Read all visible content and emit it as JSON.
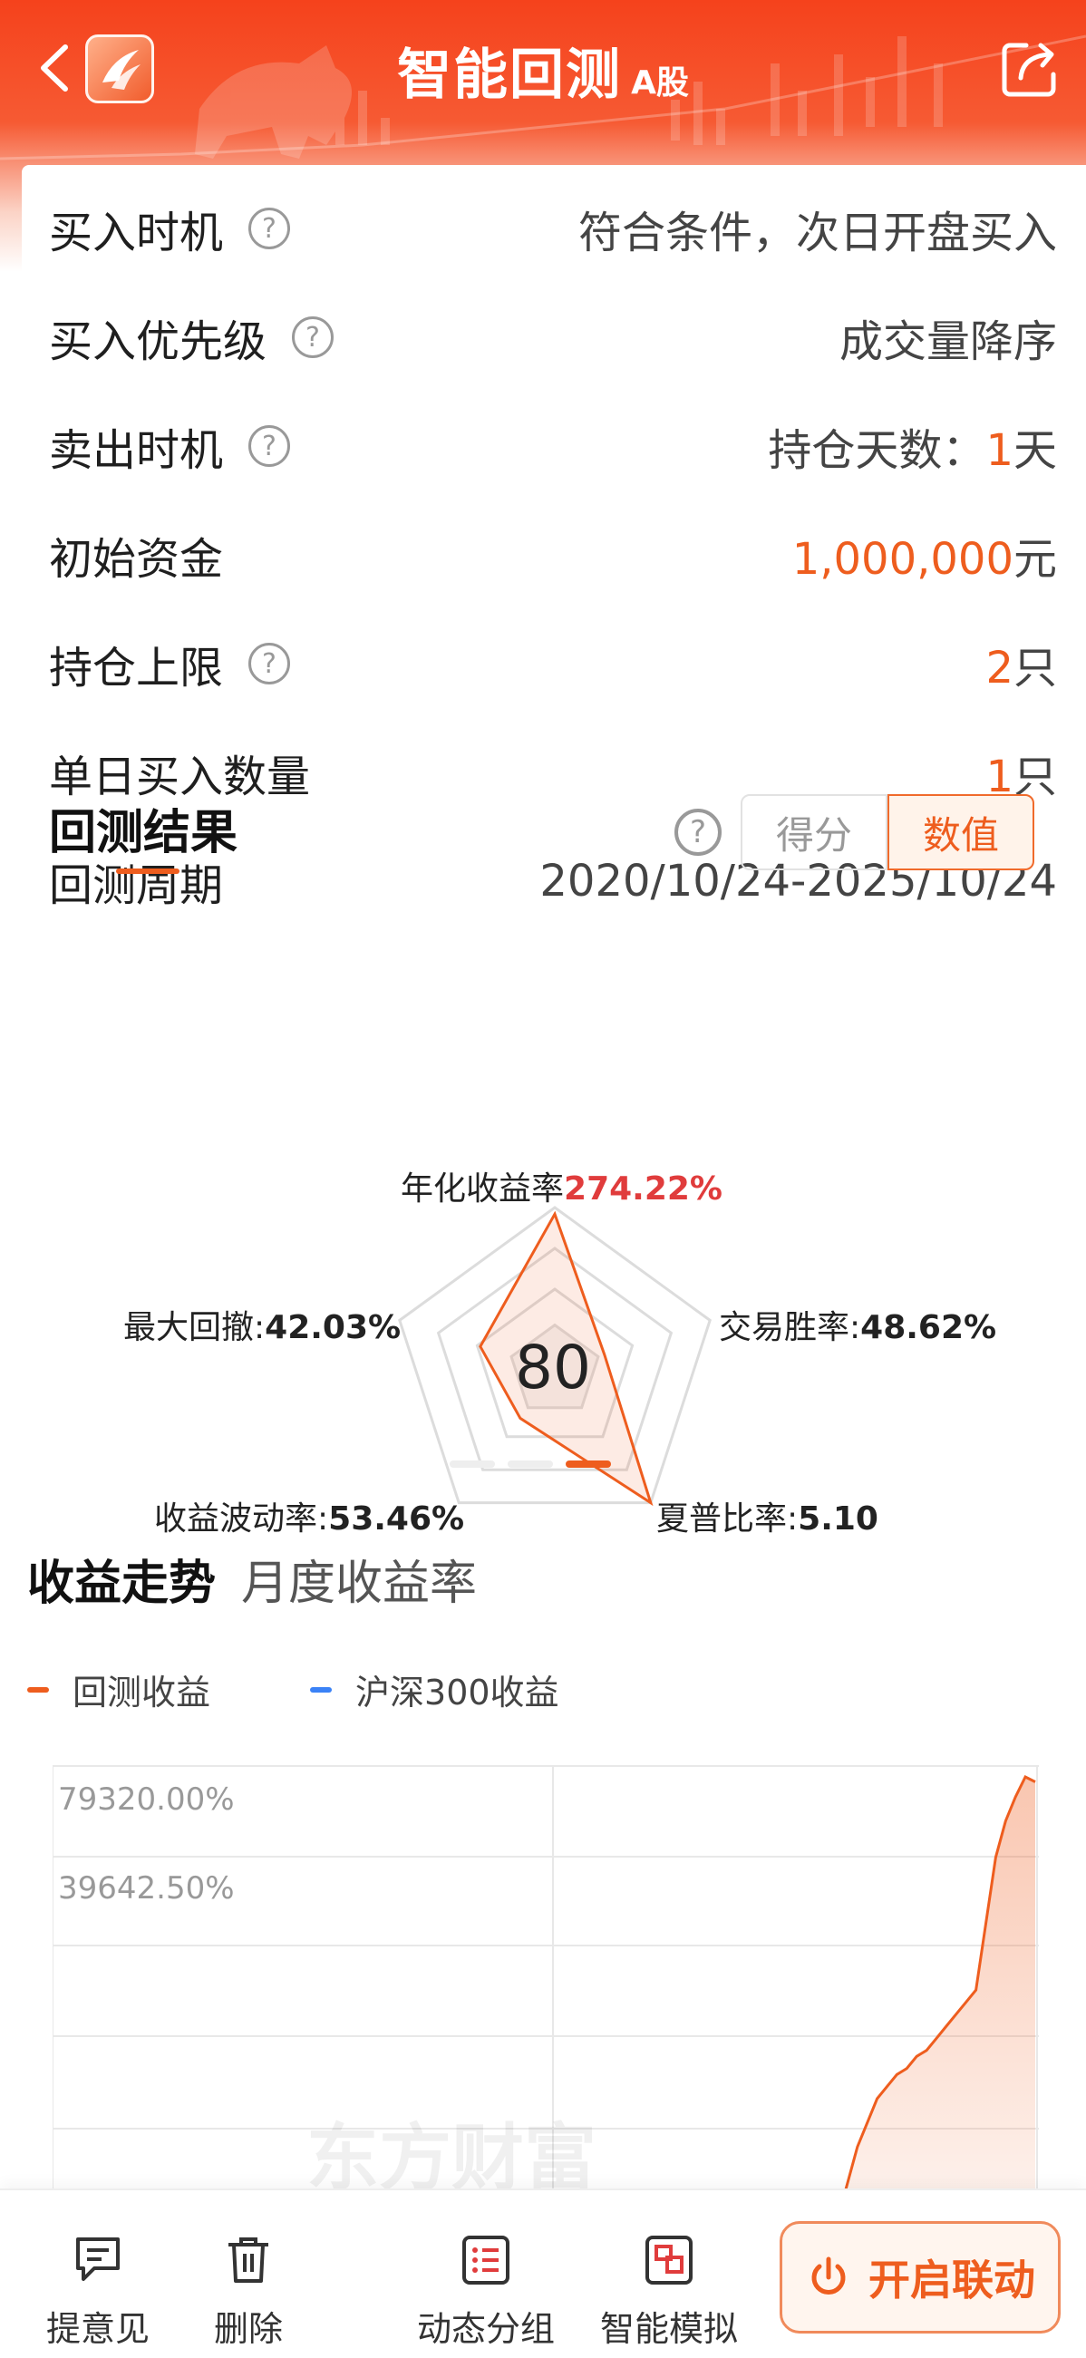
{
  "header": {
    "title": "智能回测",
    "market_tag": "A股"
  },
  "settings": [
    {
      "label": "买入时机",
      "has_help": true,
      "value": "符合条件，次日开盘买入"
    },
    {
      "label": "买入优先级",
      "has_help": true,
      "value": "成交量降序"
    },
    {
      "label": "卖出时机",
      "has_help": true,
      "value_prefix": "持仓天数：",
      "value_highlight": "1",
      "value_suffix": "天"
    },
    {
      "label": "初始资金",
      "has_help": false,
      "value_highlight": "1,000,000",
      "value_suffix": "元"
    },
    {
      "label": "持仓上限",
      "has_help": true,
      "value_highlight": "2",
      "value_suffix": "只"
    },
    {
      "label": "单日买入数量",
      "has_help": false,
      "value_highlight": "1",
      "value_suffix": "只"
    },
    {
      "label": "回测周期",
      "has_help": false,
      "value": "2020/10/24-2025/10/24"
    }
  ],
  "result": {
    "title": "回测结果",
    "toggle": {
      "score_label": "得分",
      "value_label": "数值",
      "active": "value"
    },
    "score": "80",
    "metrics": {
      "annual_return": {
        "label": "年化收益率",
        "value": "274.22%"
      },
      "win_rate": {
        "label": "交易胜率:",
        "value": "48.62%"
      },
      "sharpe": {
        "label": "夏普比率:",
        "value": "5.10"
      },
      "volatility": {
        "label": "收益波动率:",
        "value": "53.46%"
      },
      "max_drawdown": {
        "label": "最大回撤:",
        "value": "42.03%"
      }
    },
    "radar_levels": {
      "annual_return": 0.96,
      "win_rate": 0.32,
      "sharpe": 1.0,
      "volatility": 0.36,
      "max_drawdown": 0.48
    },
    "pager": {
      "count": 3,
      "active": 3
    }
  },
  "trend": {
    "tabs": [
      "收益走势",
      "月度收益率"
    ],
    "active_tab": 0,
    "legend": [
      {
        "name": "回测收益",
        "color": "#ee5d1e"
      },
      {
        "name": "沪深300收益",
        "color": "#3b82f6"
      }
    ],
    "y_ticks": [
      "79320.00%",
      "39642.50%"
    ],
    "watermark": "东方财富"
  },
  "chart_data": {
    "type": "line",
    "ylim": [
      0,
      79320
    ],
    "series": [
      {
        "name": "回测收益",
        "values": [
          0,
          0,
          0,
          0,
          0,
          0,
          0,
          0,
          0,
          0,
          0,
          0,
          0,
          0,
          0,
          0,
          0,
          0,
          0,
          0,
          0,
          0,
          0,
          0,
          0,
          0,
          0,
          0,
          0,
          0,
          0,
          0,
          0,
          0,
          0,
          0,
          0,
          0,
          0,
          0,
          0,
          0,
          0,
          0,
          0,
          0,
          0,
          0,
          0,
          0,
          0,
          0,
          0,
          0,
          0,
          0,
          0,
          0,
          0,
          0,
          0,
          0,
          0,
          0,
          0,
          0,
          0,
          0,
          0,
          0,
          0,
          0,
          0,
          0,
          0,
          0,
          0,
          0,
          2000,
          6000,
          12000,
          18000,
          22000,
          26000,
          28000,
          30000,
          31000,
          33000,
          34000,
          36000,
          38000,
          40000,
          42000,
          44000,
          55000,
          66000,
          72000,
          76000,
          79320,
          78500
        ]
      }
    ]
  },
  "bottom_bar": {
    "items": [
      {
        "label": "提意见",
        "icon": "feedback-icon"
      },
      {
        "label": "删除",
        "icon": "trash-icon"
      },
      {
        "label": "动态分组",
        "icon": "list-icon"
      },
      {
        "label": "智能模拟",
        "icon": "simulate-icon"
      }
    ],
    "cta_label": "开启联动"
  },
  "colors": {
    "accent": "#ee5d1e",
    "header": "#f5421c"
  }
}
